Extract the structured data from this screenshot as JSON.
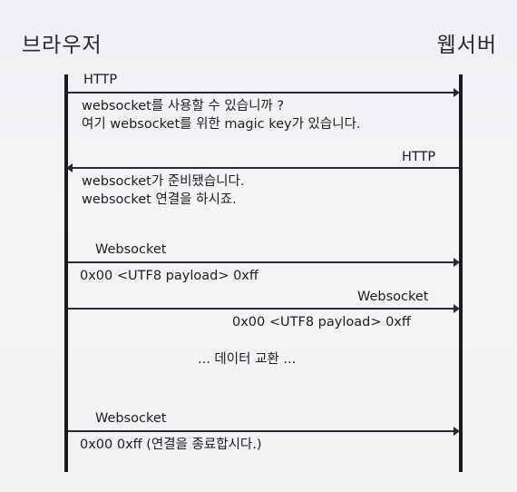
{
  "actors": {
    "browser": "브라우저",
    "server": "웹서버"
  },
  "messages": [
    {
      "protocol": "HTTP",
      "lines": [
        "websocket를 사용할 수 있습니까 ?",
        "여기 websocket를 위한 magic key가 있습니다."
      ]
    },
    {
      "protocol": "HTTP",
      "lines": [
        "websocket가 준비됐습니다.",
        "websocket 연결을 하시죠."
      ]
    },
    {
      "protocol": "Websocket",
      "lines": [
        "0x00 <UTF8 payload> 0xff"
      ]
    },
    {
      "protocol": "Websocket",
      "lines": [
        "0x00 <UTF8 payload> 0xff"
      ]
    },
    {
      "protocol": "Websocket",
      "lines": [
        "0x00 0xff (연결을 종료합시다.)"
      ]
    }
  ],
  "exchange_note": "... 데이터 교환 ..."
}
